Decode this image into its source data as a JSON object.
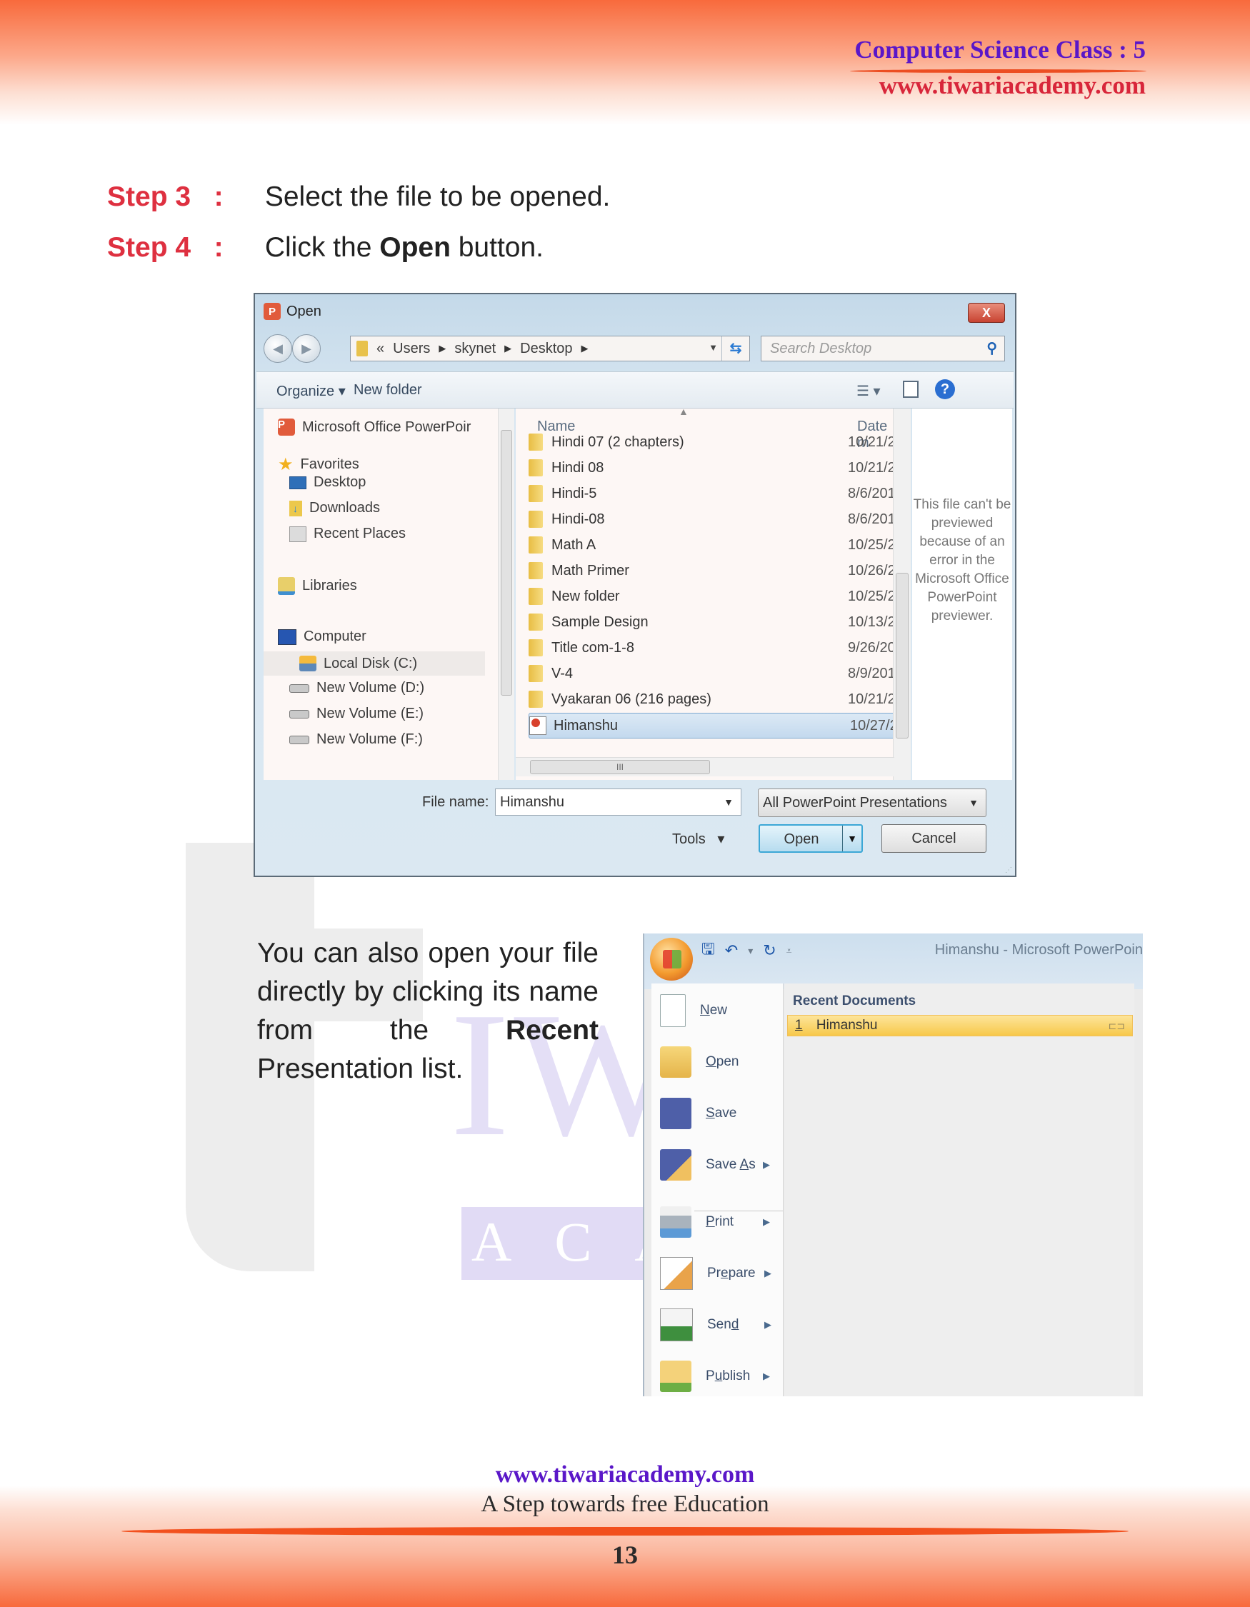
{
  "header": {
    "title": "Computer Science Class : 5",
    "url": "www.tiwariacademy.com"
  },
  "watermark": {
    "word1": "IWARI",
    "word2": "ACADEMY"
  },
  "steps": [
    {
      "label": "Step 3",
      "sep": ":",
      "text": "Select the file to be opened."
    },
    {
      "label": "Step 4",
      "sep": ":",
      "pre": "Click the ",
      "bold": "Open",
      "post": " button."
    }
  ],
  "open_dialog": {
    "title": "Open",
    "close_label": "X",
    "breadcrumb": {
      "overflow": "«",
      "parts": [
        "Users",
        "skynet",
        "Desktop"
      ]
    },
    "search_placeholder": "Search Desktop",
    "toolbar": {
      "organize": "Organize",
      "new_folder": "New folder"
    },
    "nav_pane": {
      "app_item": "Microsoft Office PowerPoir",
      "favorites_header": "Favorites",
      "favorites": [
        "Desktop",
        "Downloads",
        "Recent Places"
      ],
      "libraries": "Libraries",
      "computer_header": "Computer",
      "drives": [
        "Local Disk (C:)",
        "New Volume (D:)",
        "New Volume (E:)",
        "New Volume (F:)"
      ],
      "selected_drive": "Local Disk (C:)"
    },
    "columns": {
      "name": "Name",
      "date": "Date m"
    },
    "files": [
      {
        "name": "Hindi 07 (2 chapters)",
        "date": "10/21/2",
        "type": "folder"
      },
      {
        "name": "Hindi 08",
        "date": "10/21/2",
        "type": "folder"
      },
      {
        "name": "Hindi-5",
        "date": "8/6/201",
        "type": "folder"
      },
      {
        "name": "Hindi-08",
        "date": "8/6/201",
        "type": "folder"
      },
      {
        "name": "Math A",
        "date": "10/25/2",
        "type": "folder"
      },
      {
        "name": "Math Primer",
        "date": "10/26/2",
        "type": "folder"
      },
      {
        "name": "New folder",
        "date": "10/25/2",
        "type": "folder"
      },
      {
        "name": "Sample Design",
        "date": "10/13/2",
        "type": "folder"
      },
      {
        "name": "Title com-1-8",
        "date": "9/26/20",
        "type": "folder"
      },
      {
        "name": "V-4",
        "date": "8/9/201",
        "type": "folder"
      },
      {
        "name": "Vyakaran 06 (216 pages)",
        "date": "10/21/2",
        "type": "folder"
      },
      {
        "name": "Himanshu",
        "date": "10/27/2",
        "type": "pptx",
        "selected": true
      }
    ],
    "preview_message": "This file can't be previewed because of an error in the Microsoft Office PowerPoint previewer.",
    "file_name_label": "File name:",
    "file_name_value": "Himanshu",
    "file_type_value": "All PowerPoint Presentations",
    "tools_label": "Tools",
    "open_label": "Open",
    "cancel_label": "Cancel"
  },
  "paragraph": {
    "pre": "You can also open your file directly by clicking its name from the ",
    "bold": "Recent",
    "post": " Presentation list."
  },
  "office_menu": {
    "window_title": "Himanshu - Microsoft PowerPoin",
    "items": [
      {
        "pre": "",
        "ul": "N",
        "post": "ew",
        "submenu": false
      },
      {
        "pre": "",
        "ul": "O",
        "post": "pen",
        "submenu": false
      },
      {
        "pre": "",
        "ul": "S",
        "post": "ave",
        "submenu": false
      },
      {
        "pre": "Save ",
        "ul": "A",
        "post": "s",
        "submenu": true
      },
      {
        "pre": "",
        "ul": "P",
        "post": "rint",
        "submenu": true
      },
      {
        "pre": "Pr",
        "ul": "e",
        "post": "pare",
        "submenu": true
      },
      {
        "pre": "Sen",
        "ul": "d",
        "post": "",
        "submenu": true
      },
      {
        "pre": "P",
        "ul": "u",
        "post": "blish",
        "submenu": true
      }
    ],
    "recent_header": "Recent Documents",
    "recent_items": [
      {
        "num": "1",
        "name": "Himanshu"
      }
    ]
  },
  "footer": {
    "url": "www.tiwariacademy.com",
    "tagline": "A Step towards free Education",
    "page_number": "13"
  }
}
